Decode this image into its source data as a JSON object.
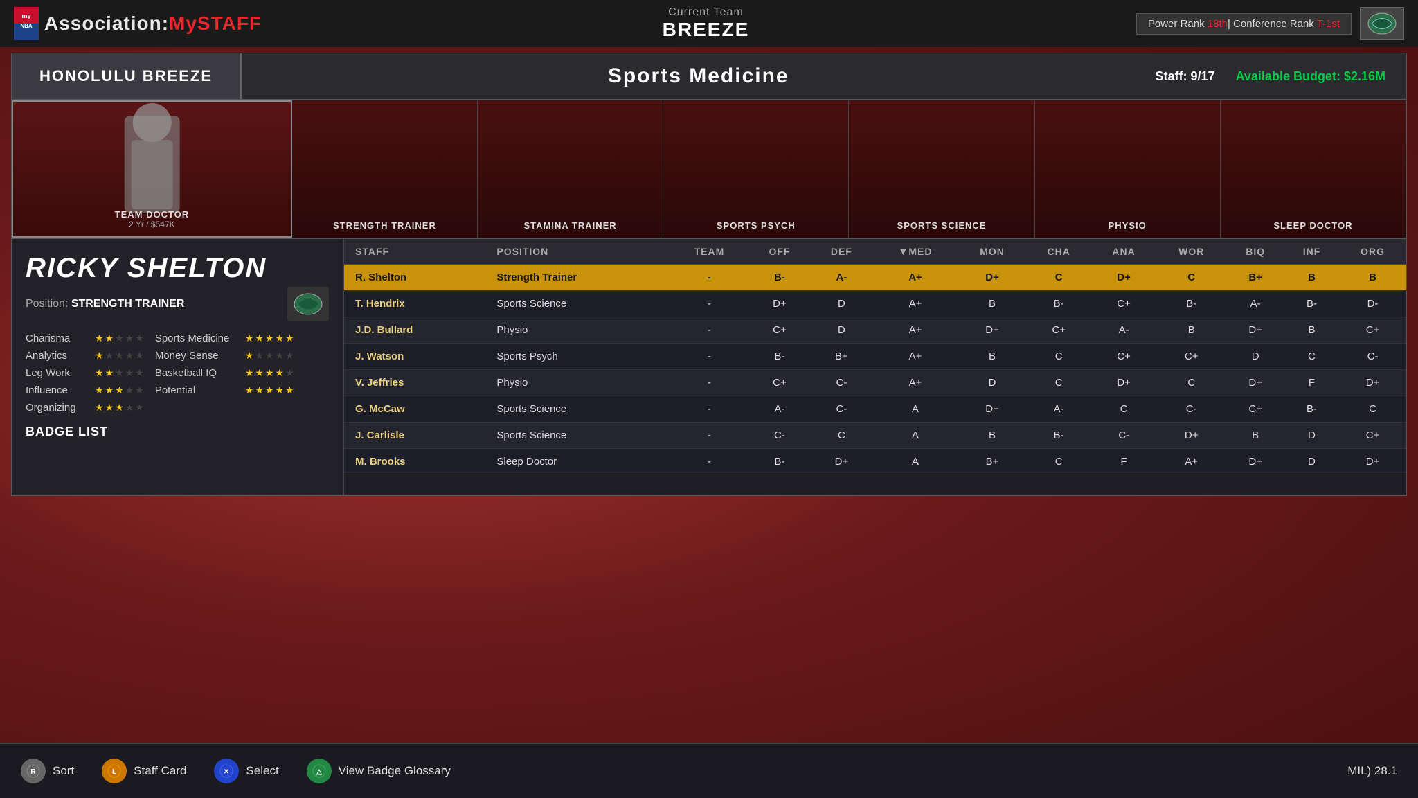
{
  "nav": {
    "logo_text": "myNBA",
    "title_association": "Association:",
    "title_mystaff": "MySTAFF",
    "current_team_label": "Current Team",
    "current_team_name": "BREEZE",
    "power_rank_label": "Power Rank",
    "power_rank_value": "18th",
    "conference_rank_label": "Conference Rank",
    "conference_rank_value": "T-1st"
  },
  "header": {
    "team_name": "HONOLULU BREEZE",
    "section": "Sports Medicine",
    "staff_label": "Staff:",
    "staff_current": "9",
    "staff_max": "17",
    "budget_label": "Available Budget:",
    "budget_value": "$2.16M"
  },
  "staff_cards": [
    {
      "role": "TEAM DOCTOR",
      "sublabel": "2 Yr / $547K",
      "active": true
    },
    {
      "role": "STRENGTH TRAINER",
      "sublabel": "",
      "active": false
    },
    {
      "role": "STAMINA TRAINER",
      "sublabel": "",
      "active": false
    },
    {
      "role": "SPORTS PSYCH",
      "sublabel": "",
      "active": false
    },
    {
      "role": "SPORTS SCIENCE",
      "sublabel": "",
      "active": false
    },
    {
      "role": "PHYSIO",
      "sublabel": "",
      "active": false
    },
    {
      "role": "SLEEP DOCTOR",
      "sublabel": "",
      "active": false
    }
  ],
  "player": {
    "name": "RICKY SHELTON",
    "position_label": "Position:",
    "position_value": "STRENGTH TRAINER",
    "stats": [
      {
        "name": "Charisma",
        "stars": 2,
        "category": "Sports Medicine",
        "cat_stars": 5
      },
      {
        "name": "Analytics",
        "stars": 1,
        "category": "Money Sense",
        "cat_stars": 1
      },
      {
        "name": "Leg Work",
        "stars": 2,
        "category": "Basketball IQ",
        "cat_stars": 4
      },
      {
        "name": "Influence",
        "stars": 3,
        "category": "Potential",
        "cat_stars": 5
      },
      {
        "name": "Organizing",
        "stars": 3,
        "category": "",
        "cat_stars": 0
      }
    ],
    "badge_list_label": "BADGE LIST"
  },
  "table": {
    "columns": [
      "STAFF",
      "POSITION",
      "TEAM",
      "OFF",
      "DEF",
      "MED",
      "MON",
      "CHA",
      "ANA",
      "WOR",
      "BIQ",
      "INF",
      "ORG"
    ],
    "rows": [
      {
        "name": "R. Shelton",
        "position": "Strength Trainer",
        "team": "-",
        "off": "B-",
        "def": "A-",
        "med": "A+",
        "mon": "D+",
        "cha": "C",
        "ana": "D+",
        "wor": "C",
        "biq": "B+",
        "inf": "B",
        "org": "B",
        "highlighted": true
      },
      {
        "name": "T. Hendrix",
        "position": "Sports Science",
        "team": "-",
        "off": "D+",
        "def": "D",
        "med": "A+",
        "mon": "B",
        "cha": "B-",
        "ana": "C+",
        "wor": "B-",
        "biq": "A-",
        "inf": "B-",
        "org": "D-",
        "highlighted": false
      },
      {
        "name": "J.D. Bullard",
        "position": "Physio",
        "team": "-",
        "off": "C+",
        "def": "D",
        "med": "A+",
        "mon": "D+",
        "cha": "C+",
        "ana": "A-",
        "wor": "B",
        "biq": "D+",
        "inf": "B",
        "org": "C+",
        "highlighted": false
      },
      {
        "name": "J. Watson",
        "position": "Sports Psych",
        "team": "-",
        "off": "B-",
        "def": "B+",
        "med": "A+",
        "mon": "B",
        "cha": "C",
        "ana": "C+",
        "wor": "C+",
        "biq": "D",
        "inf": "C",
        "org": "C-",
        "highlighted": false
      },
      {
        "name": "V. Jeffries",
        "position": "Physio",
        "team": "-",
        "off": "C+",
        "def": "C-",
        "med": "A+",
        "mon": "D",
        "cha": "C",
        "ana": "D+",
        "wor": "C",
        "biq": "D+",
        "inf": "F",
        "org": "D+",
        "highlighted": false
      },
      {
        "name": "G. McCaw",
        "position": "Sports Science",
        "team": "-",
        "off": "A-",
        "def": "C-",
        "med": "A",
        "mon": "D+",
        "cha": "A-",
        "ana": "C",
        "wor": "C-",
        "biq": "C+",
        "inf": "B-",
        "org": "C",
        "highlighted": false
      },
      {
        "name": "J. Carlisle",
        "position": "Sports Science",
        "team": "-",
        "off": "C-",
        "def": "C",
        "med": "A",
        "mon": "B",
        "cha": "B-",
        "ana": "C-",
        "wor": "D+",
        "biq": "B",
        "inf": "D",
        "org": "C+",
        "highlighted": false
      },
      {
        "name": "M. Brooks",
        "position": "Sleep Doctor",
        "team": "-",
        "off": "B-",
        "def": "D+",
        "med": "A",
        "mon": "B+",
        "cha": "C",
        "ana": "F",
        "wor": "A+",
        "biq": "D+",
        "inf": "D",
        "org": "D+",
        "highlighted": false
      }
    ]
  },
  "bottom_bar": {
    "sort_label": "Sort",
    "staff_card_label": "Staff Card",
    "select_label": "Select",
    "view_badge_label": "View Badge Glossary",
    "right_info": "MIL) 28.1"
  }
}
